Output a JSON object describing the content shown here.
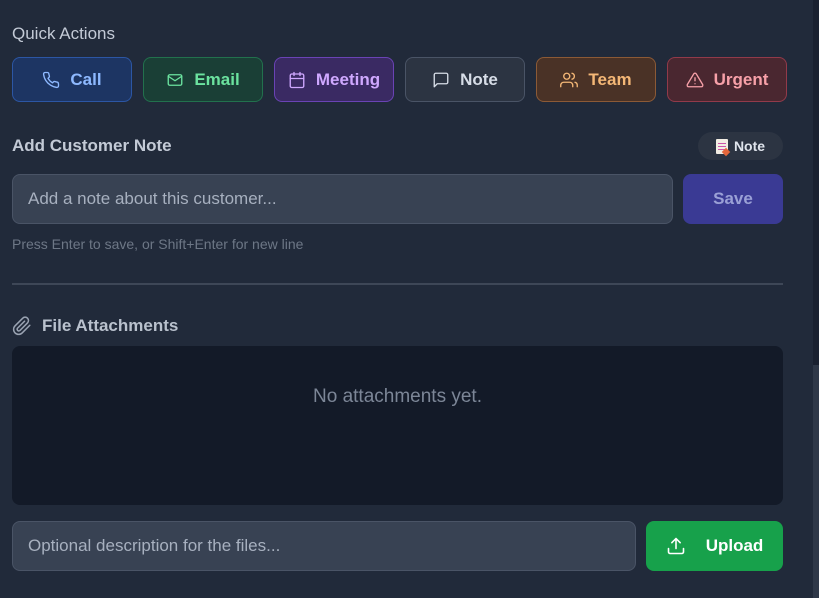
{
  "quick_actions": {
    "title": "Quick Actions",
    "buttons": [
      {
        "label": "Call",
        "icon": "phone-icon",
        "color": "#8eb9ff"
      },
      {
        "label": "Email",
        "icon": "mail-icon",
        "color": "#6be39f"
      },
      {
        "label": "Meeting",
        "icon": "calendar-icon",
        "color": "#cfa8ff"
      },
      {
        "label": "Note",
        "icon": "speech-bubble-icon",
        "color": "#d7dde7"
      },
      {
        "label": "Team",
        "icon": "users-icon",
        "color": "#f4b776"
      },
      {
        "label": "Urgent",
        "icon": "warning-icon",
        "color": "#f7a0a8"
      }
    ]
  },
  "customer_note": {
    "title": "Add Customer Note",
    "badge_label": "Note",
    "badge_icon": "memo-icon",
    "input_placeholder": "Add a note about this customer...",
    "save_label": "Save",
    "hint": "Press Enter to save, or Shift+Enter for new line"
  },
  "attachments": {
    "title": "File Attachments",
    "icon": "paperclip-icon",
    "empty_text": "No attachments yet.",
    "description_placeholder": "Optional description for the files...",
    "upload_label": "Upload",
    "upload_icon": "upload-icon"
  },
  "colors": {
    "background": "#212a3a",
    "save_button": "#3a3a94",
    "upload_button": "#17a14b"
  }
}
